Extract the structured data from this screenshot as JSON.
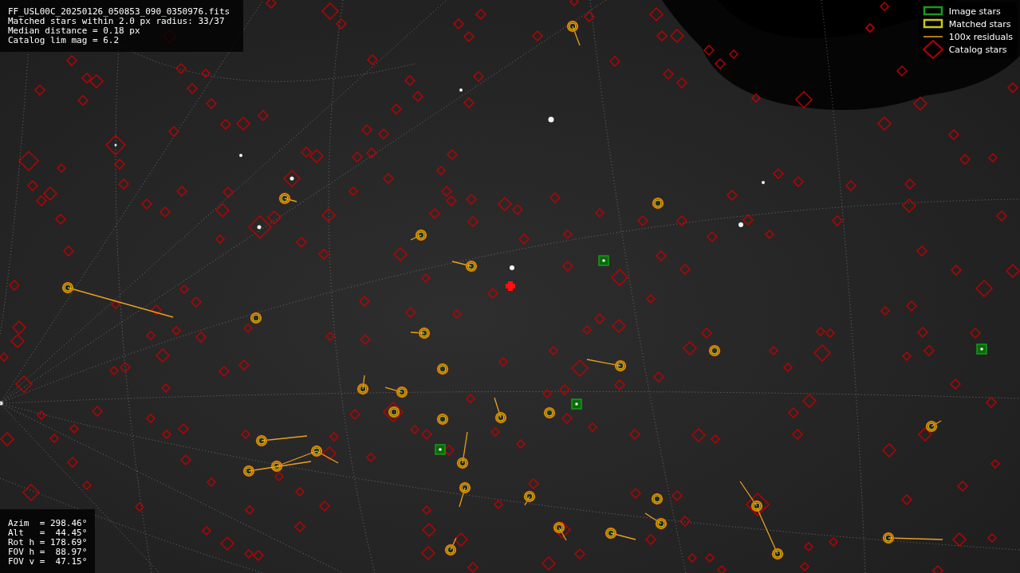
{
  "file_info": {
    "lines": [
      "FF_USL00C_20250126_050853_090_0350976.fits",
      "Matched stars within 2.0 px radius: 33/37",
      "Median distance = 0.18 px",
      "Catalog lim mag = 6.2"
    ]
  },
  "legend": {
    "items": [
      {
        "label": "Image stars"
      },
      {
        "kind": "matched",
        "label": "Matched stars"
      },
      {
        "kind": "residual",
        "label": "100x residuals"
      },
      {
        "kind": "catalog",
        "label": "Catalog stars"
      }
    ]
  },
  "pointing": {
    "lines": [
      "Azim  = 298.46°",
      "Alt   =  44.45°",
      "Rot h = 178.69°",
      "FOV h =  88.97°",
      "FOV v =  47.15°"
    ]
  }
}
